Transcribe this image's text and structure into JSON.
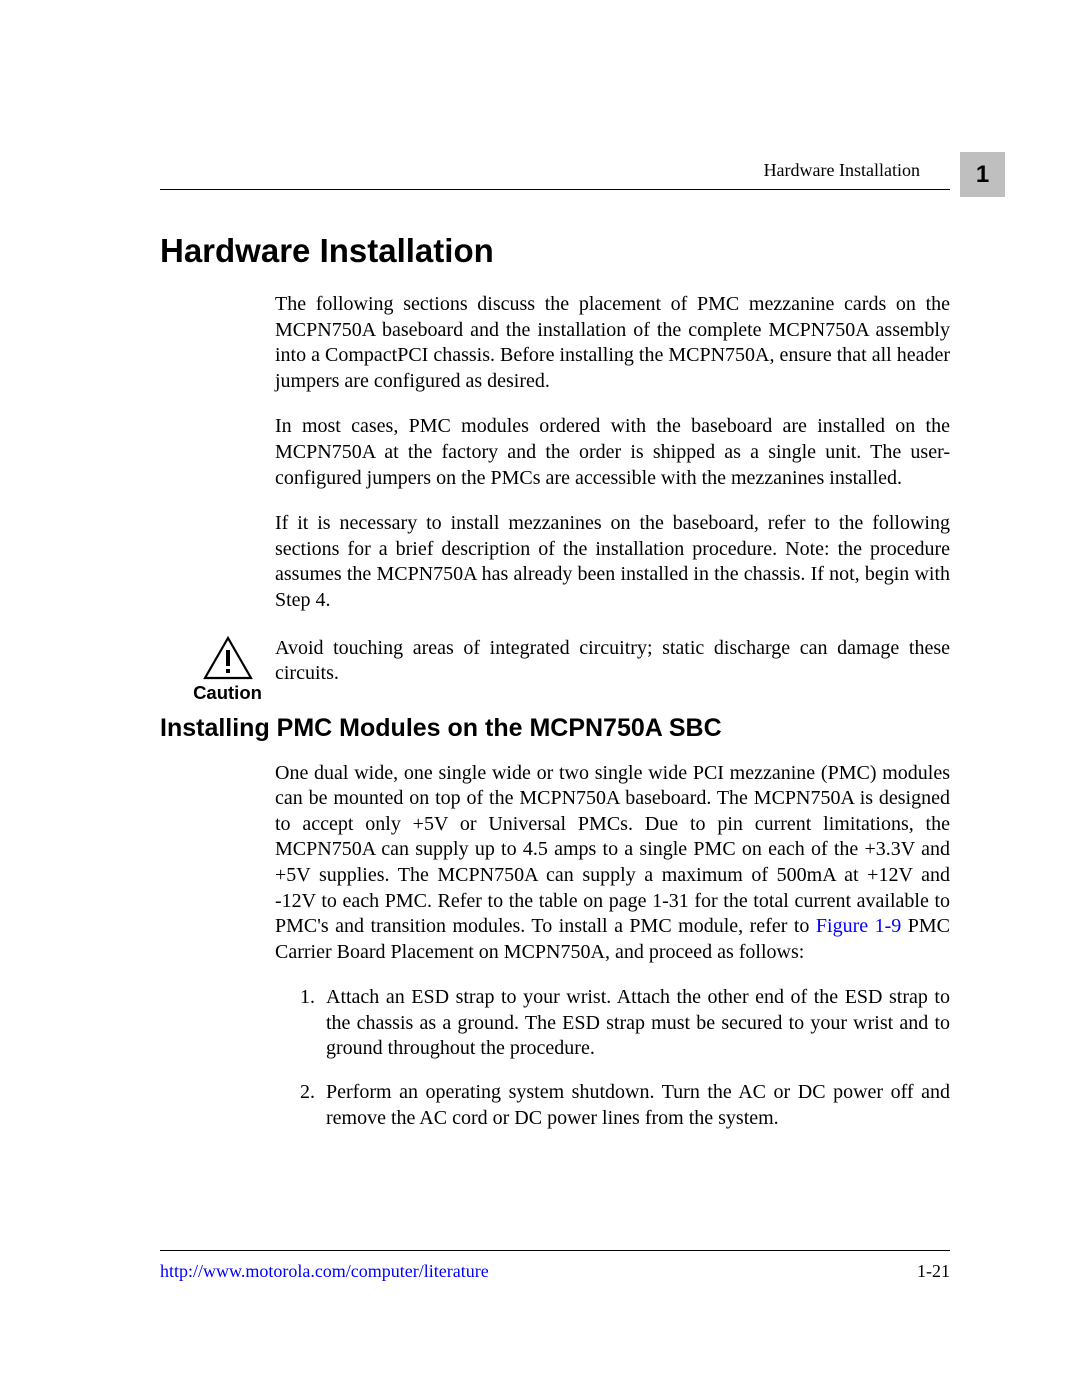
{
  "header": {
    "running_head": "Hardware Installation",
    "chapter_number": "1"
  },
  "title": "Hardware Installation",
  "intro_paras": [
    "The following sections discuss the placement of PMC mezzanine cards on the MCPN750A baseboard and the installation of the complete MCPN750A assembly into a CompactPCI chassis. Before installing the MCPN750A, ensure that all header jumpers are configured as desired.",
    "In most cases, PMC modules ordered with the baseboard are installed on the MCPN750A at the factory and the order is shipped as a single unit. The user-configured jumpers on the PMCs are accessible with the mezzanines installed.",
    "If it is necessary to install mezzanines on the baseboard, refer to the following sections for a brief description of the installation procedure. Note: the procedure assumes the MCPN750A has already been installed in the chassis. If not, begin with Step 4."
  ],
  "caution": {
    "label": "Caution",
    "text": "Avoid touching areas of integrated circuitry; static discharge can damage these circuits."
  },
  "subsection_title": "Installing PMC Modules on the MCPN750A SBC",
  "subsection_para_pre": "One dual wide, one single wide or two single wide PCI mezzanine (PMC) modules can be mounted on top of the MCPN750A baseboard. The MCPN750A is designed to accept only +5V or Universal PMCs. Due to pin current limitations, the MCPN750A can supply up to 4.5 amps to a single PMC on each of the +3.3V and +5V supplies. The MCPN750A can supply a maximum of 500mA at +12V and -12V to each PMC. Refer to the table on page 1-31 for the total current available to PMC's and transition modules. To install a PMC module, refer to ",
  "subsection_link": "Figure 1-9",
  "subsection_para_post": " PMC Carrier Board Placement on MCPN750A, and proceed as follows:",
  "steps": [
    "Attach an ESD strap to your wrist. Attach the other end of the ESD strap to the chassis as a ground. The ESD strap must be secured to your wrist and to ground throughout the procedure.",
    "Perform an operating system shutdown. Turn the AC or DC power off and remove the AC cord or DC power lines from the system."
  ],
  "footer": {
    "url": "http://www.motorola.com/computer/literature",
    "page": "1-21"
  }
}
